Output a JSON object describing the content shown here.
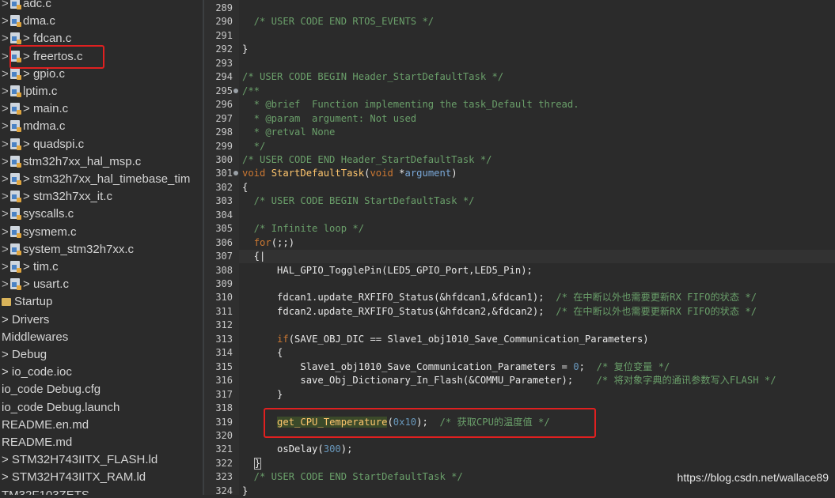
{
  "sidebar": {
    "items": [
      {
        "label": "adc.c",
        "kind": "file",
        "arrow": false
      },
      {
        "label": "dma.c",
        "kind": "file",
        "arrow": false
      },
      {
        "label": "fdcan.c",
        "kind": "file",
        "arrow": true
      },
      {
        "label": "freertos.c",
        "kind": "file",
        "arrow": true
      },
      {
        "label": "gpio.c",
        "kind": "file",
        "arrow": true
      },
      {
        "label": "lptim.c",
        "kind": "file",
        "arrow": false
      },
      {
        "label": "main.c",
        "kind": "file",
        "arrow": true
      },
      {
        "label": "mdma.c",
        "kind": "file",
        "arrow": false
      },
      {
        "label": "quadspi.c",
        "kind": "file",
        "arrow": true
      },
      {
        "label": "stm32h7xx_hal_msp.c",
        "kind": "file",
        "arrow": false
      },
      {
        "label": "stm32h7xx_hal_timebase_tim",
        "kind": "file",
        "arrow": true
      },
      {
        "label": "stm32h7xx_it.c",
        "kind": "file",
        "arrow": true
      },
      {
        "label": "syscalls.c",
        "kind": "file",
        "arrow": false
      },
      {
        "label": "sysmem.c",
        "kind": "file",
        "arrow": false
      },
      {
        "label": "system_stm32h7xx.c",
        "kind": "file",
        "arrow": false
      },
      {
        "label": "tim.c",
        "kind": "file",
        "arrow": true
      },
      {
        "label": "usart.c",
        "kind": "file",
        "arrow": true
      },
      {
        "label": "Startup",
        "kind": "folder"
      },
      {
        "label": "> Drivers",
        "kind": "text"
      },
      {
        "label": "Middlewares",
        "kind": "text"
      },
      {
        "label": "> Debug",
        "kind": "text"
      },
      {
        "label": "> io_code.ioc",
        "kind": "text"
      },
      {
        "label": "io_code Debug.cfg",
        "kind": "text"
      },
      {
        "label": "io_code Debug.launch",
        "kind": "text"
      },
      {
        "label": "README.en.md",
        "kind": "text"
      },
      {
        "label": "README.md",
        "kind": "text"
      },
      {
        "label": "> STM32H743IITX_FLASH.ld",
        "kind": "text"
      },
      {
        "label": "> STM32H743IITX_RAM.ld",
        "kind": "text"
      },
      {
        "label": "TM32F103ZETS",
        "kind": "text"
      }
    ]
  },
  "editor": {
    "lines": [
      {
        "n": "289",
        "segs": []
      },
      {
        "n": "290",
        "segs": [
          {
            "t": "  /* USER CODE END RTOS_EVENTS */",
            "c": "c-com"
          }
        ]
      },
      {
        "n": "291",
        "segs": []
      },
      {
        "n": "292",
        "segs": [
          {
            "t": "}",
            "c": ""
          }
        ]
      },
      {
        "n": "293",
        "segs": []
      },
      {
        "n": "294",
        "segs": [
          {
            "t": "/* USER CODE BEGIN Header_StartDefaultTask */",
            "c": "c-com"
          }
        ]
      },
      {
        "n": "295",
        "fold": true,
        "segs": [
          {
            "t": "/**",
            "c": "c-com"
          }
        ]
      },
      {
        "n": "296",
        "segs": [
          {
            "t": "  * @brief  Function implementing the task_Default thread.",
            "c": "c-com"
          }
        ]
      },
      {
        "n": "297",
        "segs": [
          {
            "t": "  * @param  argument: Not used",
            "c": "c-com"
          }
        ]
      },
      {
        "n": "298",
        "segs": [
          {
            "t": "  * @retval None",
            "c": "c-com"
          }
        ]
      },
      {
        "n": "299",
        "segs": [
          {
            "t": "  */",
            "c": "c-com"
          }
        ]
      },
      {
        "n": "300",
        "segs": [
          {
            "t": "/* USER CODE END Header_StartDefaultTask */",
            "c": "c-com"
          }
        ]
      },
      {
        "n": "301",
        "fold": true,
        "segs": [
          {
            "t": "void ",
            "c": "c-kw"
          },
          {
            "t": "StartDefaultTask",
            "c": "c-fn"
          },
          {
            "t": "(",
            "c": ""
          },
          {
            "t": "void",
            "c": "c-kw"
          },
          {
            "t": " *",
            "c": ""
          },
          {
            "t": "argument",
            "c": "c-par"
          },
          {
            "t": ")",
            "c": ""
          }
        ]
      },
      {
        "n": "302",
        "segs": [
          {
            "t": "{",
            "c": ""
          }
        ]
      },
      {
        "n": "303",
        "segs": [
          {
            "t": "  /* USER CODE BEGIN StartDefaultTask */",
            "c": "c-com"
          }
        ]
      },
      {
        "n": "304",
        "segs": []
      },
      {
        "n": "305",
        "segs": [
          {
            "t": "  /* Infinite loop */",
            "c": "c-com"
          }
        ]
      },
      {
        "n": "306",
        "segs": [
          {
            "t": "  ",
            "c": ""
          },
          {
            "t": "for",
            "c": "c-kw"
          },
          {
            "t": "(;;)",
            "c": ""
          }
        ]
      },
      {
        "n": "307",
        "current": true,
        "segs": [
          {
            "t": "  {",
            "c": ""
          },
          {
            "t": "|",
            "c": ""
          }
        ]
      },
      {
        "n": "308",
        "segs": [
          {
            "t": "      HAL_GPIO_TogglePin(LED5_GPIO_Port,LED5_Pin);",
            "c": ""
          }
        ]
      },
      {
        "n": "309",
        "segs": []
      },
      {
        "n": "310",
        "segs": [
          {
            "t": "      fdcan1.update_RXFIFO_Status(&hfdcan1,&fdcan1);  ",
            "c": ""
          },
          {
            "t": "/* 在中断以外也需要更新RX FIFO的状态 */",
            "c": "c-com"
          }
        ]
      },
      {
        "n": "311",
        "segs": [
          {
            "t": "      fdcan2.update_RXFIFO_Status(&hfdcan2,&fdcan2);  ",
            "c": ""
          },
          {
            "t": "/* 在中断以外也需要更新RX FIFO的状态 */",
            "c": "c-com"
          }
        ]
      },
      {
        "n": "312",
        "segs": []
      },
      {
        "n": "313",
        "segs": [
          {
            "t": "      ",
            "c": ""
          },
          {
            "t": "if",
            "c": "c-kw"
          },
          {
            "t": "(SAVE_OBJ_DIC == Slave1_obj1010_Save_Communication_Parameters)",
            "c": ""
          }
        ]
      },
      {
        "n": "314",
        "segs": [
          {
            "t": "      {",
            "c": ""
          }
        ]
      },
      {
        "n": "315",
        "segs": [
          {
            "t": "          Slave1_obj1010_Save_Communication_Parameters = ",
            "c": ""
          },
          {
            "t": "0",
            "c": "c-num"
          },
          {
            "t": ";  ",
            "c": ""
          },
          {
            "t": "/* 复位变量 */",
            "c": "c-com"
          }
        ]
      },
      {
        "n": "316",
        "segs": [
          {
            "t": "          save_Obj_Dictionary_In_Flash(&COMMU_Parameter);    ",
            "c": ""
          },
          {
            "t": "/* 将对象字典的通讯参数写入FLASH */",
            "c": "c-com"
          }
        ]
      },
      {
        "n": "317",
        "segs": [
          {
            "t": "      }",
            "c": ""
          }
        ]
      },
      {
        "n": "318",
        "segs": []
      },
      {
        "n": "319",
        "segs": [
          {
            "t": "      ",
            "c": ""
          },
          {
            "t": "get_CPU_Temperature",
            "c": "c-hl"
          },
          {
            "t": "(",
            "c": ""
          },
          {
            "t": "0x10",
            "c": "c-num"
          },
          {
            "t": ");  ",
            "c": ""
          },
          {
            "t": "/* 获取CPU的温度值 */",
            "c": "c-com"
          }
        ]
      },
      {
        "n": "320",
        "segs": []
      },
      {
        "n": "321",
        "segs": [
          {
            "t": "      osDelay(",
            "c": ""
          },
          {
            "t": "300",
            "c": "c-num"
          },
          {
            "t": ");",
            "c": ""
          }
        ]
      },
      {
        "n": "322",
        "segs": [
          {
            "t": "  ",
            "c": ""
          },
          {
            "t": "}",
            "c": "box"
          }
        ]
      },
      {
        "n": "323",
        "segs": [
          {
            "t": "  /* USER CODE END StartDefaultTask */",
            "c": "c-com"
          }
        ]
      },
      {
        "n": "324",
        "segs": [
          {
            "t": "}",
            "c": ""
          }
        ]
      }
    ]
  },
  "watermark": "https://blog.csdn.net/wallace89",
  "colors": {
    "highlight_box": "#e02020",
    "comment": "#6a9f6a",
    "keyword": "#cc7832"
  }
}
